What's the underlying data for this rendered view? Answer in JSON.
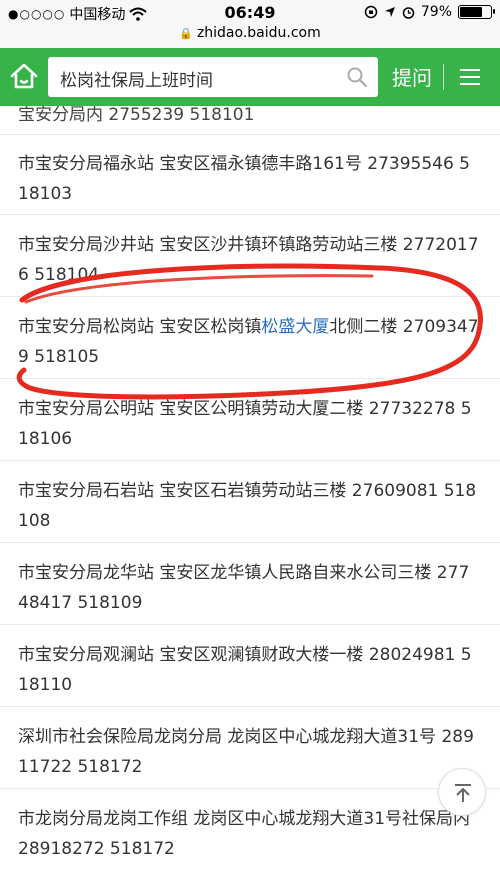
{
  "status_bar": {
    "carrier": "中国移动",
    "time": "06:49",
    "battery": "79%",
    "battery_level": 0.79,
    "url": "zhidao.baidu.com"
  },
  "header": {
    "search_query": "松岗社保局上班时间",
    "ask_label": "提问"
  },
  "list": {
    "partial_top": "宝安分局内 2755239 518101",
    "entries": [
      {
        "text": "市宝安分局福永站 宝安区福永镇德丰路161号 27395546 518103"
      },
      {
        "text": "市宝安分局沙井站 宝安区沙井镇环镇路劳动站三楼 27720176 518104"
      },
      {
        "before": "市宝安分局松岗站 宝安区松岗镇",
        "link": "松盛大厦",
        "after": "北侧二楼 27093479 518105"
      },
      {
        "text": "市宝安分局公明站 宝安区公明镇劳动大厦二楼 27732278 518106"
      },
      {
        "text": "市宝安分局石岩站 宝安区石岩镇劳动站三楼 27609081 518108"
      },
      {
        "text": "市宝安分局龙华站 宝安区龙华镇人民路自来水公司三楼 27748417 518109"
      },
      {
        "text": "市宝安分局观澜站 宝安区观澜镇财政大楼一楼 28024981 518110"
      },
      {
        "text": "深圳市社会保险局龙岗分局 龙岗区中心城龙翔大道31号 28911722 518172"
      },
      {
        "text": "市龙岗分局龙岗工作组 龙岗区中心城龙翔大道31号社保局内 28918272 518172"
      }
    ]
  },
  "colors": {
    "header_green": "#38b34a",
    "link_blue": "#2a6fbf",
    "annotation_red": "#e52b1f"
  }
}
